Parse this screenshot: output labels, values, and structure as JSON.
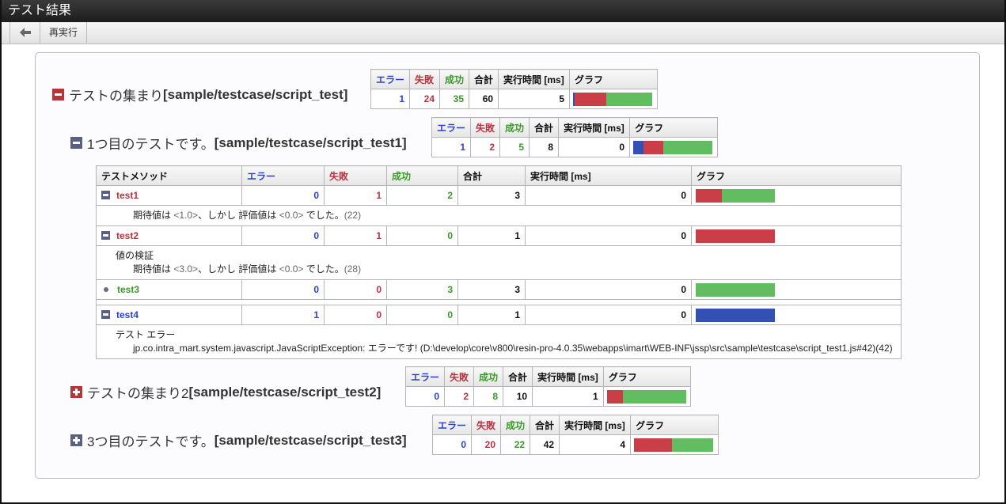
{
  "window": {
    "title": "テスト結果"
  },
  "toolbar": {
    "back_icon": "arrow-left-icon",
    "rerun_label": "再実行"
  },
  "colors": {
    "error": "#3350b5",
    "failure": "#c93e47",
    "success": "#62bd60"
  },
  "summary_headers": {
    "error": "エラー",
    "failure": "失敗",
    "success": "成功",
    "total": "合計",
    "time": "実行時間 [ms]",
    "graph": "グラフ"
  },
  "suites": [
    {
      "title_jp": "テストの集まり",
      "title_path": "[sample/testcase/script_test]",
      "state": "expanded",
      "error": 1,
      "failure": 24,
      "success": 35,
      "total": 60,
      "time": 5
    },
    {
      "title_jp": "1つ目のテストです。",
      "title_path": "[sample/testcase/script_test1]",
      "state": "expanded",
      "error": 1,
      "failure": 2,
      "success": 5,
      "total": 8,
      "time": 0
    },
    {
      "title_jp": "テストの集まり2",
      "title_path": "[sample/testcase/script_test2]",
      "state": "collapsed",
      "error": 0,
      "failure": 2,
      "success": 8,
      "total": 10,
      "time": 1
    },
    {
      "title_jp": "3つ目のテストです。",
      "title_path": "[sample/testcase/script_test3]",
      "state": "collapsed",
      "error": 0,
      "failure": 20,
      "success": 22,
      "total": 42,
      "time": 4
    }
  ],
  "methods": {
    "header": "テストメソッド",
    "rows": [
      {
        "name": "test1",
        "status": "failure",
        "error": 0,
        "failure": 1,
        "success": 2,
        "total": 3,
        "time": 0,
        "message": {
          "lines": [
            {
              "indent": true,
              "parts": [
                "期待値は ",
                "<1.0>",
                "、しかし 評価値は ",
                "<0.0>",
                " でした。",
                "(22)"
              ]
            }
          ]
        }
      },
      {
        "name": "test2",
        "status": "failure",
        "error": 0,
        "failure": 1,
        "success": 0,
        "total": 1,
        "time": 0,
        "message": {
          "lines": [
            {
              "indent": false,
              "parts": [
                "値の検証"
              ]
            },
            {
              "indent": true,
              "parts": [
                "期待値は ",
                "<3.0>",
                "、しかし 評価値は ",
                "<0.0>",
                " でした。",
                "(28)"
              ]
            }
          ]
        }
      },
      {
        "name": "test3",
        "status": "success",
        "error": 0,
        "failure": 0,
        "success": 3,
        "total": 3,
        "time": 0
      },
      {
        "name": "test4",
        "status": "error",
        "error": 1,
        "failure": 0,
        "success": 0,
        "total": 1,
        "time": 0,
        "message": {
          "lines": [
            {
              "indent": false,
              "parts": [
                "テスト エラー"
              ]
            },
            {
              "indent": true,
              "parts": [
                "jp.co.intra_mart.system.javascript.JavaScriptException: エラーです! (D:\\develop\\core\\v800\\resin-pro-4.0.35\\webapps\\imart\\WEB-INF\\jssp\\src\\sample\\testcase\\script_test1.js#42)(42)"
              ]
            }
          ]
        }
      }
    ]
  }
}
